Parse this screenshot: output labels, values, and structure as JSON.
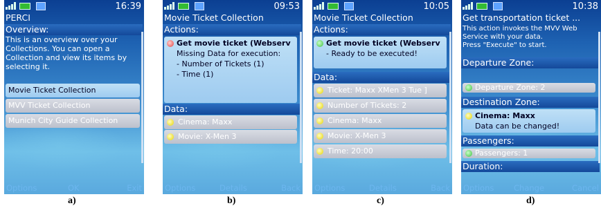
{
  "panels": {
    "a": {
      "caption": "a)",
      "time": "16:39",
      "title": "PERCI",
      "overview_label": "Overview:",
      "overview_text": [
        "This is an overview over your",
        "Collections. You can open a",
        "Collection and view its items by",
        "selecting it."
      ],
      "items": [
        "Movie Ticket Collection",
        "MVV Ticket Collection",
        "Munich City Guide Collection"
      ],
      "softkeys": {
        "left": "Options",
        "center": "OK",
        "right": "Exit"
      }
    },
    "b": {
      "caption": "b)",
      "time": "09:53",
      "title": "Movie Ticket Collection",
      "actions_label": "Actions:",
      "action_title": "Get movie ticket (Webserv",
      "action_lines": [
        "Missing Data for execution:",
        "- Number of Tickets (1)",
        "- Time (1)"
      ],
      "data_label": "Data:",
      "data_items": [
        "Cinema: Maxx",
        "Movie: X-Men 3"
      ],
      "softkeys": {
        "left": "Options",
        "center": "Details",
        "right": "Back"
      }
    },
    "c": {
      "caption": "c)",
      "time": "10:05",
      "title": "Movie Ticket Collection",
      "actions_label": "Actions:",
      "action_title": "Get movie ticket (Webserv",
      "action_lines": [
        "- Ready to be executed!"
      ],
      "data_label": "Data:",
      "data_items": [
        "Ticket: Maxx XMen 3 Tue ]",
        "Number of Tickets: 2",
        "Cinema: Maxx",
        "Movie: X-Men 3",
        "Time: 20:00"
      ],
      "softkeys": {
        "left": "Options",
        "center": "Details",
        "right": "Back"
      }
    },
    "d": {
      "caption": "d)",
      "time": "10:38",
      "title": "Get transportation ticket ...",
      "intro": [
        "This action invokes the MVV Web",
        "Service with your data.",
        "Press \"Execute\" to start."
      ],
      "departure_label": "Departure Zone:",
      "departure_value": "Departure Zone: 2",
      "destination_label": "Destination Zone:",
      "destination_title": "Cinema: Maxx",
      "destination_note": "Data can be changed!",
      "passengers_label": "Passengers:",
      "passengers_value": "Passengers: 1",
      "duration_label": "Duration:",
      "softkeys": {
        "left": "Options",
        "center": "Change",
        "right": "Cancel"
      }
    }
  }
}
